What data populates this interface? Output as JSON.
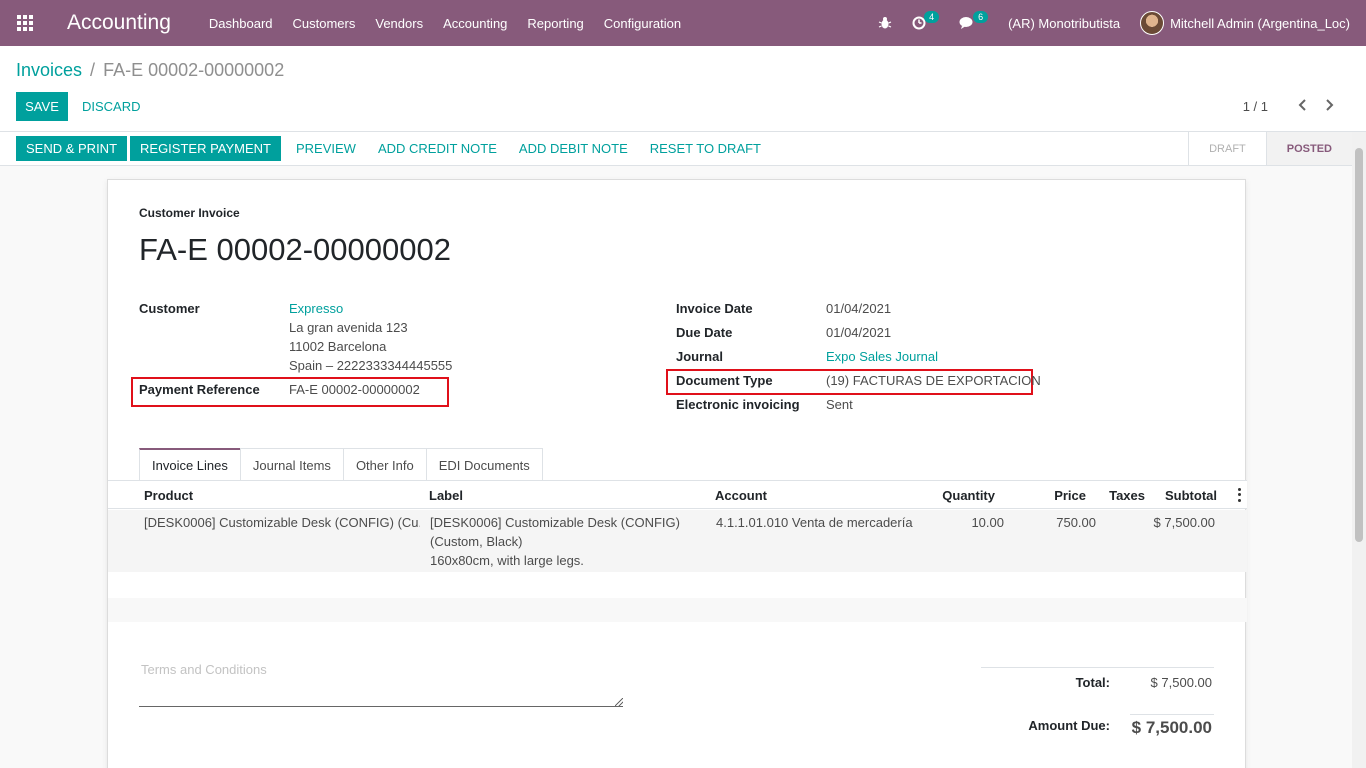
{
  "navbar": {
    "app_name": "Accounting",
    "menu": [
      "Dashboard",
      "Customers",
      "Vendors",
      "Accounting",
      "Reporting",
      "Configuration"
    ],
    "activity_count": "4",
    "message_count": "6",
    "company": "(AR) Monotributista",
    "user": "Mitchell Admin (Argentina_Loc)"
  },
  "breadcrumb": {
    "parent": "Invoices",
    "separator": "/",
    "current": "FA-E 00002-00000002"
  },
  "buttons": {
    "save": "Save",
    "discard": "Discard"
  },
  "pager": {
    "value": "1 / 1",
    "prev": "‹",
    "next": "›"
  },
  "statusbar": {
    "actions": {
      "send_print": "Send & Print",
      "register_payment": "Register Payment",
      "preview": "Preview",
      "add_credit_note": "Add Credit Note",
      "add_debit_note": "Add Debit Note",
      "reset_to_draft": "Reset to Draft"
    },
    "stages": {
      "draft": "Draft",
      "posted": "Posted"
    }
  },
  "invoice": {
    "type": "Customer Invoice",
    "name": "FA-E 00002-00000002",
    "fields": {
      "customer_label": "Customer",
      "customer_name": "Expresso",
      "address_line1": "La gran avenida 123",
      "address_line2": "11002 Barcelona",
      "address_line3": "Spain – 2222333344445555",
      "payment_ref_label": "Payment Reference",
      "payment_ref_value": "FA-E 00002-00000002",
      "invoice_date_label": "Invoice Date",
      "invoice_date_value": "01/04/2021",
      "due_date_label": "Due Date",
      "due_date_value": "01/04/2021",
      "journal_label": "Journal",
      "journal_value": "Expo Sales Journal",
      "document_type_label": "Document Type",
      "document_type_value": "(19) FACTURAS DE EXPORTACION",
      "edi_label": "Electronic invoicing",
      "edi_value": "Sent"
    },
    "tabs": [
      "Invoice Lines",
      "Journal Items",
      "Other Info",
      "EDI Documents"
    ],
    "columns": {
      "product": "Product",
      "label": "Label",
      "account": "Account",
      "quantity": "Quantity",
      "price": "Price",
      "taxes": "Taxes",
      "subtotal": "Subtotal"
    },
    "lines": [
      {
        "product": "[DESK0006] Customizable Desk (CONFIG) (Cu...",
        "label_1": "[DESK0006] Customizable Desk (CONFIG)",
        "label_2": "(Custom, Black)",
        "label_3": "160x80cm, with large legs.",
        "account": "4.1.1.01.010 Venta de mercadería",
        "quantity": "10.00",
        "price": "750.00",
        "taxes": "",
        "subtotal": "$ 7,500.00"
      }
    ],
    "terms_placeholder": "Terms and Conditions",
    "totals": {
      "total_label": "Total:",
      "total_value": "$ 7,500.00",
      "amount_due_label": "Amount Due:",
      "amount_due_value": "$ 7,500.00"
    }
  }
}
